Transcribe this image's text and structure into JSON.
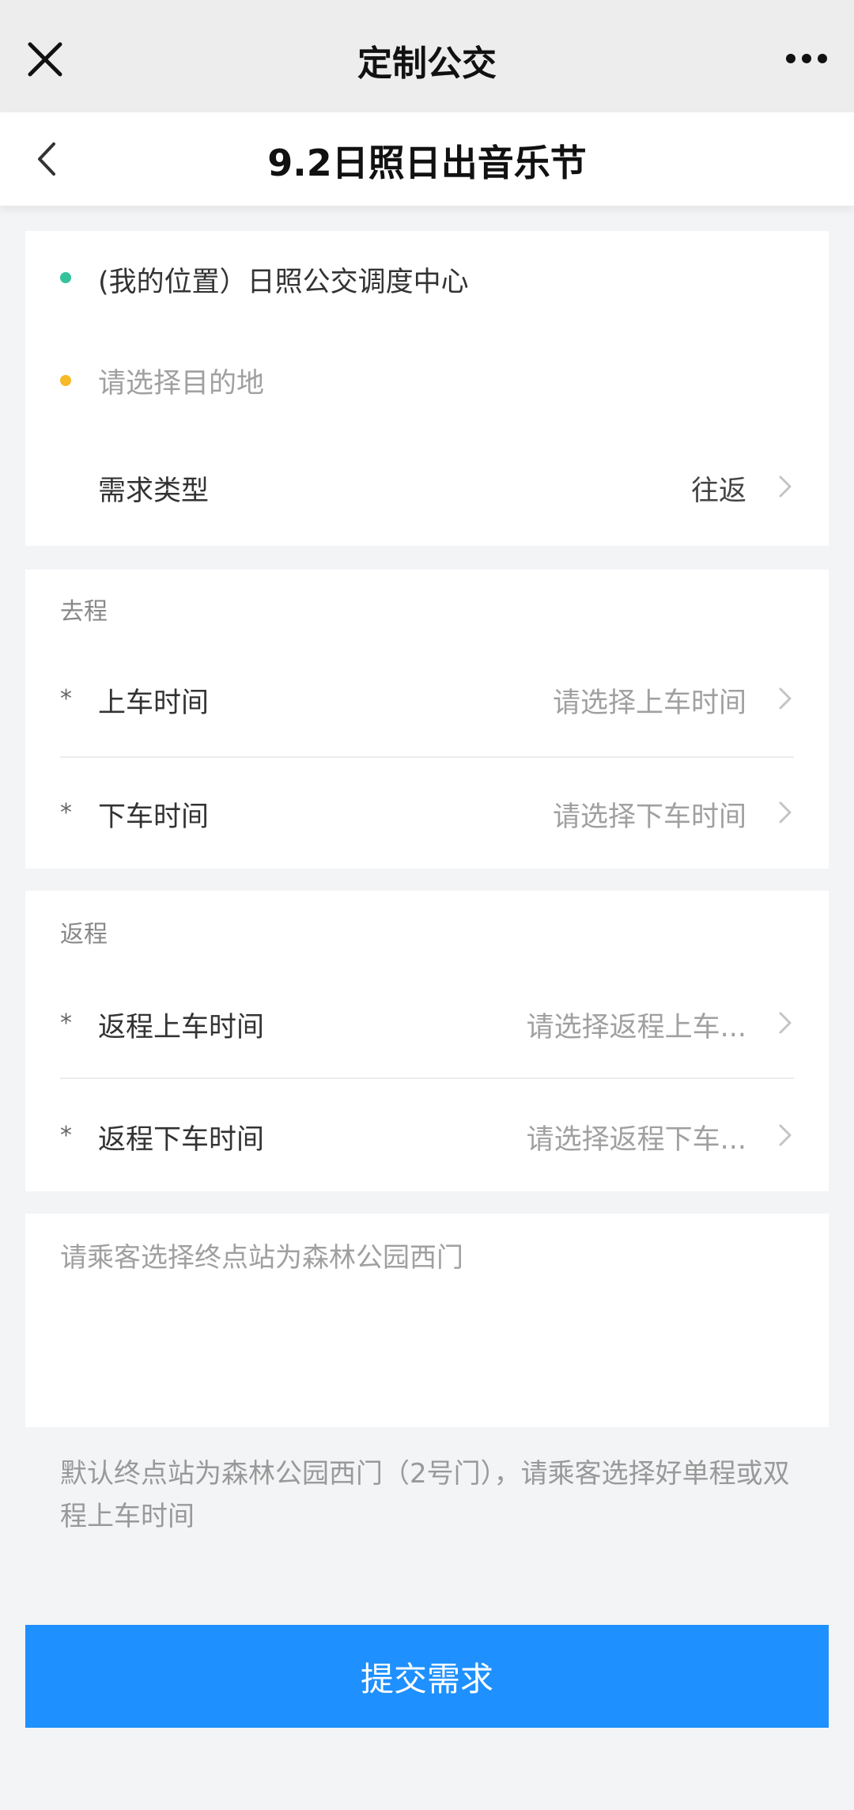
{
  "topbar": {
    "title": "定制公交"
  },
  "navbar": {
    "title": "9.2日照日出音乐节"
  },
  "route": {
    "origin": "(我的位置）日照公交调度中心",
    "destination_placeholder": "请选择目的地",
    "demand_type_label": "需求类型",
    "demand_type_value": "往返"
  },
  "outbound": {
    "section_title": "去程",
    "boarding_label": "上车时间",
    "boarding_placeholder": "请选择上车时间",
    "alighting_label": "下车时间",
    "alighting_placeholder": "请选择下车时间"
  },
  "return": {
    "section_title": "返程",
    "boarding_label": "返程上车时间",
    "boarding_placeholder": "请选择返程上车...",
    "alighting_label": "返程下车时间",
    "alighting_placeholder": "请选择返程下车..."
  },
  "remarks": {
    "placeholder": "请乘客选择终点站为森林公园西门"
  },
  "note": "默认终点站为森林公园西门（2号门），请乘客选择好单程或双程上车时间",
  "submit_label": "提交需求",
  "colors": {
    "origin_dot": "#35c39b",
    "destination_dot": "#f6b928",
    "submit_button": "#1e90ff"
  },
  "icons": {
    "close": "close-icon",
    "more": "more-icon",
    "back": "back-icon",
    "chevron": "chevron-right-icon"
  }
}
